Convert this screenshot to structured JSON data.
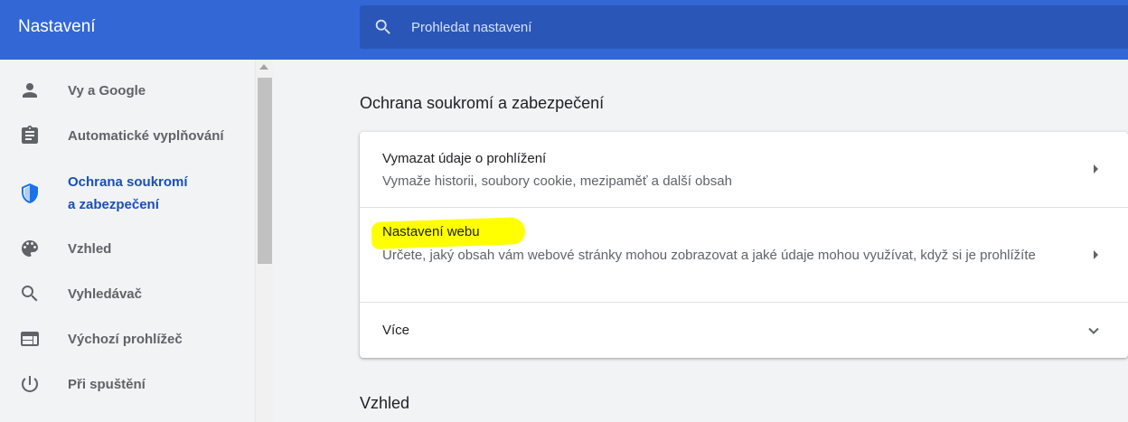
{
  "header": {
    "title": "Nastavení",
    "search_placeholder": "Prohledat nastavení"
  },
  "sidebar": {
    "items": [
      {
        "label": "Vy a Google",
        "icon": "person-icon"
      },
      {
        "label": "Automatické vyplňování",
        "icon": "clipboard-icon"
      },
      {
        "label_line1": "Ochrana soukromí",
        "label_line2": "a zabezpečení",
        "icon": "shield-icon",
        "active": true
      },
      {
        "label": "Vzhled",
        "icon": "palette-icon"
      },
      {
        "label": "Vyhledávač",
        "icon": "search-icon"
      },
      {
        "label": "Výchozí prohlížeč",
        "icon": "browser-icon"
      },
      {
        "label": "Při spuštění",
        "icon": "power-icon"
      }
    ]
  },
  "main": {
    "section_title": "Ochrana soukromí a zabezpečení",
    "rows": [
      {
        "title": "Vymazat údaje o prohlížení",
        "description": "Vymaže historii, soubory cookie, mezipaměť a další obsah"
      },
      {
        "title": "Nastavení webu",
        "description": "Určete, jaký obsah vám webové stránky mohou zobrazovat a jaké údaje mohou využívat, když si je prohlížíte"
      },
      {
        "title": "Více"
      }
    ],
    "next_section_title": "Vzhled"
  },
  "colors": {
    "header_bg": "#3367d6",
    "search_bg": "#2a56b8",
    "active_nav": "#1a4fb8",
    "highlight": "#ffff00"
  }
}
